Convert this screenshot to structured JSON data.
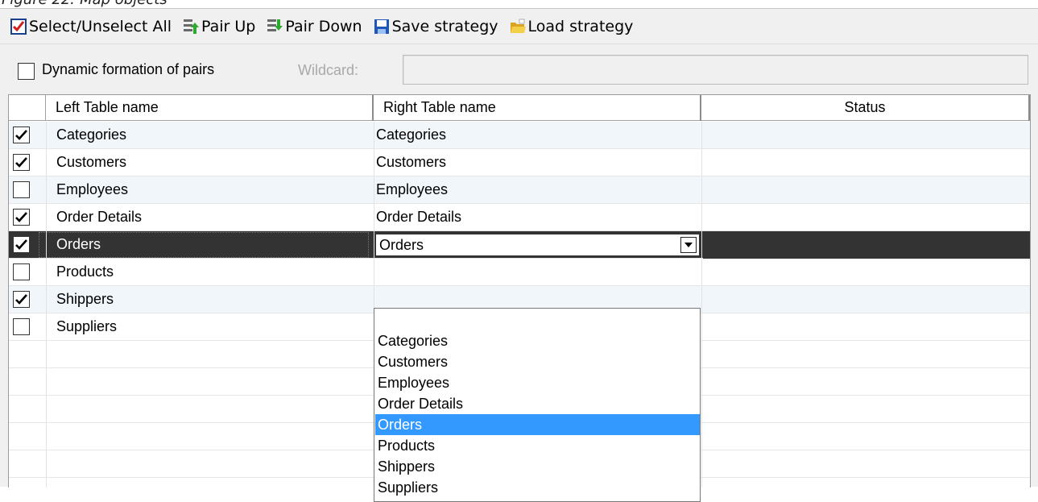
{
  "caption": "Figure 22: Map objects",
  "toolbar": {
    "buttons": [
      {
        "label": "Select/Unselect All",
        "icon": "checkbox-checked-icon"
      },
      {
        "label": "Pair Up",
        "icon": "pair-up-icon"
      },
      {
        "label": "Pair Down",
        "icon": "pair-down-icon"
      },
      {
        "label": "Save strategy",
        "icon": "save-icon"
      },
      {
        "label": "Load strategy",
        "icon": "open-folder-icon"
      }
    ]
  },
  "options": {
    "dynamic_label": "Dynamic formation of pairs",
    "dynamic_checked": false,
    "wildcard_label": "Wildcard:",
    "wildcard_value": ""
  },
  "grid": {
    "columns": [
      "Left Table name",
      "Right Table name",
      "Status"
    ],
    "rows": [
      {
        "checked": true,
        "left": "Categories",
        "right": "Categories",
        "status": ""
      },
      {
        "checked": true,
        "left": "Customers",
        "right": "Customers",
        "status": ""
      },
      {
        "checked": false,
        "left": "Employees",
        "right": "Employees",
        "status": ""
      },
      {
        "checked": true,
        "left": "Order Details",
        "right": "Order Details",
        "status": ""
      },
      {
        "checked": true,
        "left": "Orders",
        "right": "Orders",
        "status": "",
        "selected": true
      },
      {
        "checked": false,
        "left": "Products",
        "right": "",
        "status": ""
      },
      {
        "checked": true,
        "left": "Shippers",
        "right": "",
        "status": ""
      },
      {
        "checked": false,
        "left": "Suppliers",
        "right": "",
        "status": ""
      }
    ]
  },
  "dropdown": {
    "selected": "Orders",
    "options": [
      "",
      "Categories",
      "Customers",
      "Employees",
      "Order Details",
      "Orders",
      "Products",
      "Shippers",
      "Suppliers"
    ]
  },
  "colors": {
    "selection_row": "#333333",
    "highlight": "#3399ff",
    "alt_row": "#f1f6fb"
  }
}
